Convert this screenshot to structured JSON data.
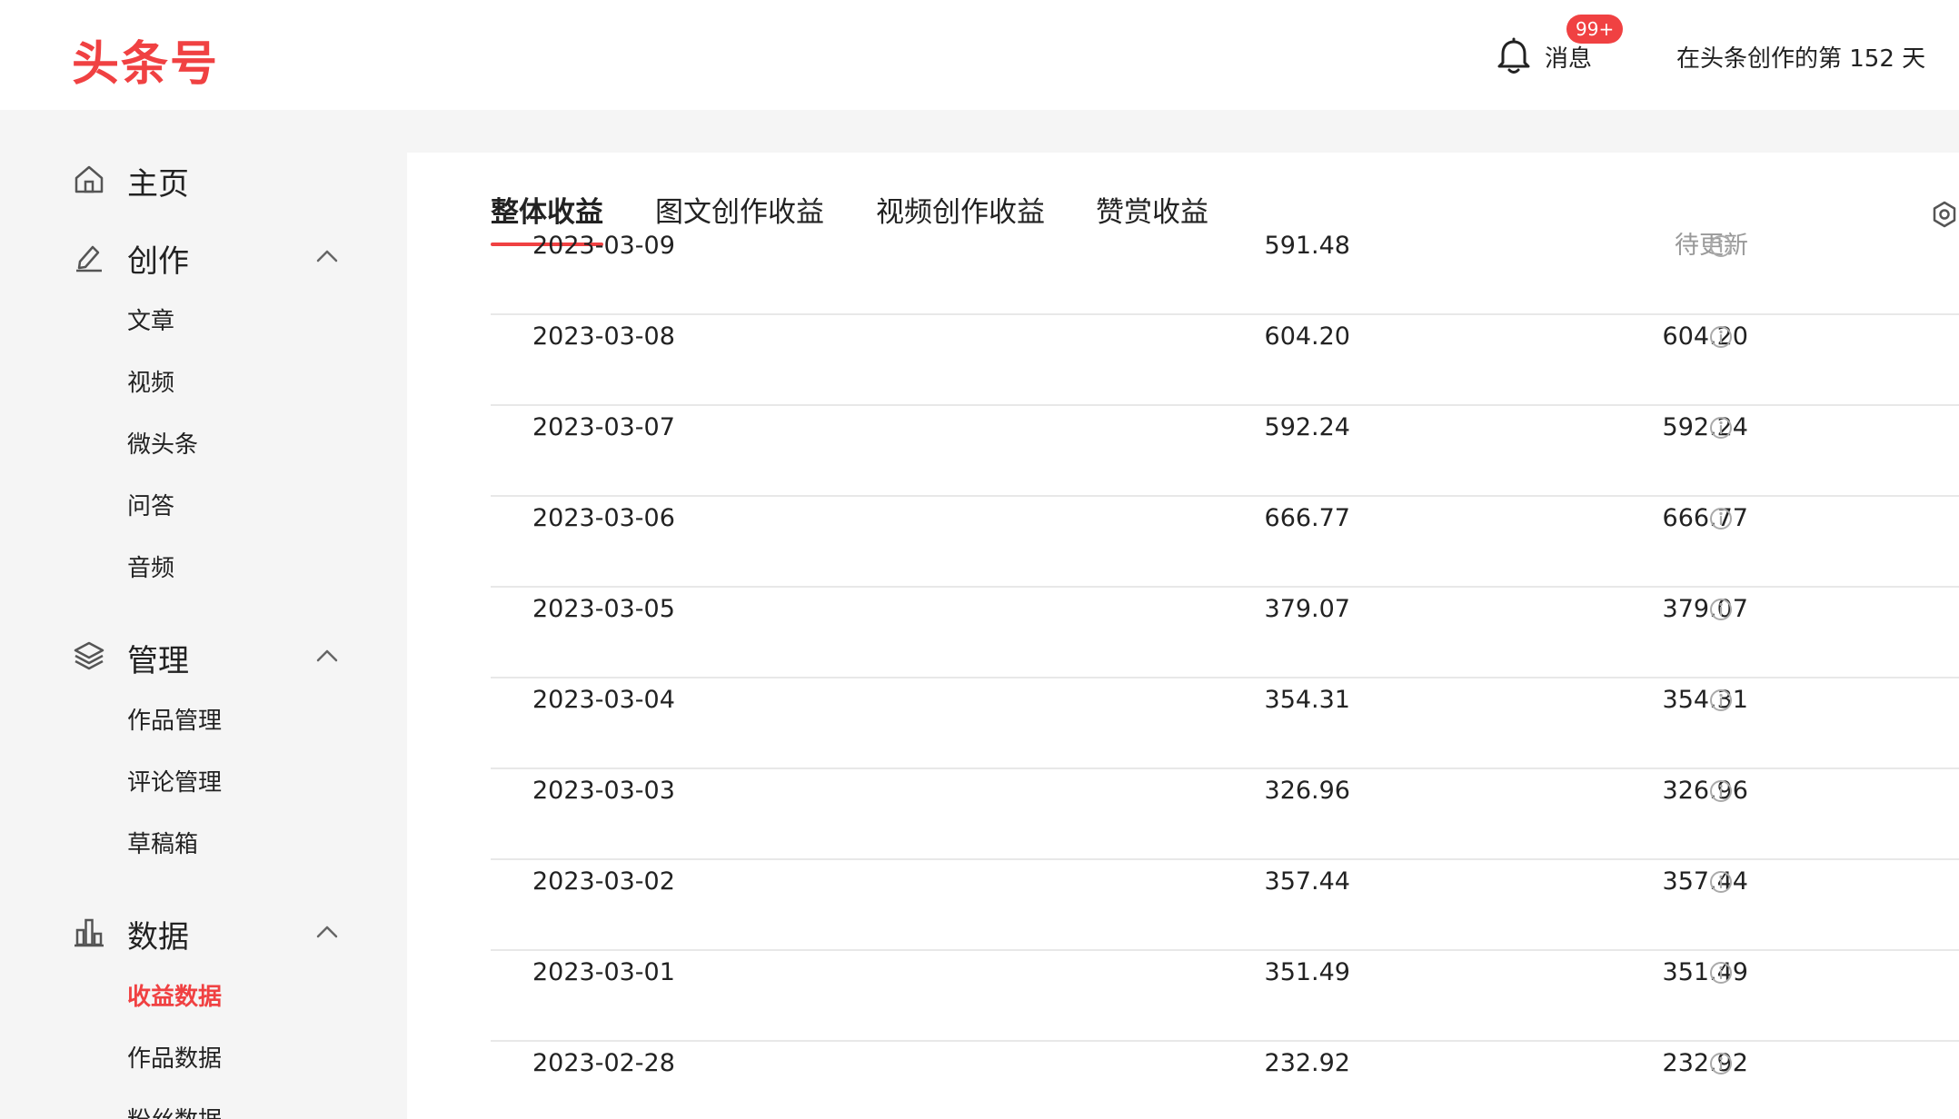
{
  "header": {
    "logo": "头条号",
    "messages_label": "消息",
    "messages_badge": "99+",
    "days_text": "在头条创作的第 152 天"
  },
  "sidebar": {
    "home": "主页",
    "create": {
      "label": "创作",
      "items": [
        "文章",
        "视频",
        "微头条",
        "问答",
        "音频"
      ]
    },
    "manage": {
      "label": "管理",
      "items": [
        "作品管理",
        "评论管理",
        "草稿箱"
      ]
    },
    "data": {
      "label": "数据",
      "items": [
        "收益数据",
        "作品数据",
        "粉丝数据"
      ],
      "active_index": 0
    }
  },
  "tabs": [
    "整体收益",
    "图文创作收益",
    "视频创作收益",
    "赞赏收益"
  ],
  "active_tab": 0,
  "table": {
    "rows": [
      {
        "date": "2023-03-09",
        "estimate": "591.48",
        "settled": "待更新",
        "pending": true
      },
      {
        "date": "2023-03-08",
        "estimate": "604.20",
        "settled": "604.20",
        "pending": false
      },
      {
        "date": "2023-03-07",
        "estimate": "592.24",
        "settled": "592.24",
        "pending": false
      },
      {
        "date": "2023-03-06",
        "estimate": "666.77",
        "settled": "666.77",
        "pending": false
      },
      {
        "date": "2023-03-05",
        "estimate": "379.07",
        "settled": "379.07",
        "pending": false
      },
      {
        "date": "2023-03-04",
        "estimate": "354.31",
        "settled": "354.31",
        "pending": false
      },
      {
        "date": "2023-03-03",
        "estimate": "326.96",
        "settled": "326.96",
        "pending": false
      },
      {
        "date": "2023-03-02",
        "estimate": "357.44",
        "settled": "357.44",
        "pending": false
      },
      {
        "date": "2023-03-01",
        "estimate": "351.49",
        "settled": "351.49",
        "pending": false
      },
      {
        "date": "2023-02-28",
        "estimate": "232.92",
        "settled": "232.92",
        "pending": false
      }
    ]
  },
  "colors": {
    "accent": "#f04142",
    "text": "#222222",
    "muted": "#999999",
    "divider": "#e8e8e8"
  }
}
